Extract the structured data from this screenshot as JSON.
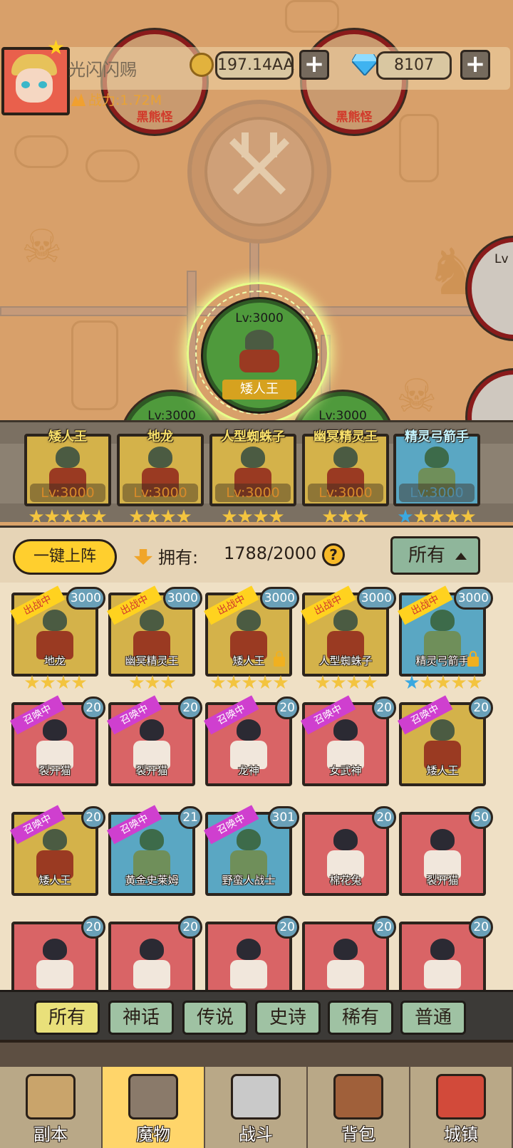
{
  "player": {
    "name": "光闪闪赐",
    "power_label": "战力:1.72M",
    "gold": "197.14AA",
    "gems": "8107"
  },
  "map": {
    "nodes": [
      {
        "label": "黑熊怪"
      },
      {
        "label": "黑熊怪"
      }
    ],
    "hero_node": {
      "level": "Lv:3000",
      "name": "矮人王"
    },
    "side_level": "Lv",
    "partial_levels": [
      "Lv:3000",
      "Lv:3000"
    ]
  },
  "lineup": [
    {
      "name": "矮人王",
      "level": "Lv:3000",
      "stars": 5,
      "blue_stars": 0,
      "color": "gold"
    },
    {
      "name": "地龙",
      "level": "Lv:3000",
      "stars": 4,
      "blue_stars": 0,
      "color": "gold"
    },
    {
      "name": "人型蜘蛛子",
      "level": "Lv:3000",
      "stars": 4,
      "blue_stars": 0,
      "color": "gold"
    },
    {
      "name": "幽冥精灵王",
      "level": "Lv:3000",
      "stars": 3,
      "blue_stars": 0,
      "color": "gold"
    },
    {
      "name": "精灵弓箭手",
      "level": "Lv:3000",
      "stars": 5,
      "blue_stars": 1,
      "color": "blue"
    }
  ],
  "toolbar": {
    "one_key_label": "一键上阵",
    "own_label": "拥有:",
    "own_count": "1788/2000",
    "help_symbol": "?",
    "filter_label": "所有"
  },
  "tags": {
    "battle": "出战中",
    "summon": "召唤中"
  },
  "monsters": [
    {
      "name": "地龙",
      "count": "3000",
      "tag": "battle",
      "color": "gold",
      "stars": 4,
      "blue_stars": 0,
      "locked": false
    },
    {
      "name": "幽冥精灵王",
      "count": "3000",
      "tag": "battle",
      "color": "gold",
      "stars": 3,
      "blue_stars": 0,
      "locked": false
    },
    {
      "name": "矮人王",
      "count": "3000",
      "tag": "battle",
      "color": "gold",
      "stars": 5,
      "blue_stars": 0,
      "locked": true
    },
    {
      "name": "人型蜘蛛子",
      "count": "3000",
      "tag": "battle",
      "color": "gold",
      "stars": 4,
      "blue_stars": 0,
      "locked": false
    },
    {
      "name": "精灵弓箭手",
      "count": "3000",
      "tag": "battle",
      "color": "blue",
      "stars": 5,
      "blue_stars": 1,
      "locked": true
    },
    {
      "name": "裂开猫",
      "count": "20",
      "tag": "summon",
      "color": "red",
      "stars": 0,
      "blue_stars": 0,
      "locked": false
    },
    {
      "name": "裂开猫",
      "count": "20",
      "tag": "summon",
      "color": "red",
      "stars": 0,
      "blue_stars": 0,
      "locked": false
    },
    {
      "name": "龙神",
      "count": "20",
      "tag": "summon",
      "color": "red",
      "stars": 0,
      "blue_stars": 0,
      "locked": false
    },
    {
      "name": "女武神",
      "count": "20",
      "tag": "summon",
      "color": "red",
      "stars": 0,
      "blue_stars": 0,
      "locked": false
    },
    {
      "name": "矮人王",
      "count": "20",
      "tag": "summon",
      "color": "gold",
      "stars": 0,
      "blue_stars": 0,
      "locked": false
    },
    {
      "name": "矮人王",
      "count": "20",
      "tag": "summon",
      "color": "gold",
      "stars": 0,
      "blue_stars": 0,
      "locked": false
    },
    {
      "name": "黄金史莱姆",
      "count": "21",
      "tag": "summon",
      "color": "blue",
      "stars": 0,
      "blue_stars": 0,
      "locked": false
    },
    {
      "name": "野蛮人战士",
      "count": "301",
      "tag": "summon",
      "color": "blue",
      "stars": 0,
      "blue_stars": 0,
      "locked": false
    },
    {
      "name": "棉花兔",
      "count": "20",
      "tag": "",
      "color": "red",
      "stars": 0,
      "blue_stars": 0,
      "locked": false
    },
    {
      "name": "裂开猫",
      "count": "50",
      "tag": "",
      "color": "red",
      "stars": 0,
      "blue_stars": 0,
      "locked": false
    },
    {
      "name": "",
      "count": "20",
      "tag": "",
      "color": "red",
      "stars": 0,
      "blue_stars": 0,
      "locked": false
    },
    {
      "name": "",
      "count": "20",
      "tag": "",
      "color": "red",
      "stars": 0,
      "blue_stars": 0,
      "locked": false
    },
    {
      "name": "",
      "count": "20",
      "tag": "",
      "color": "red",
      "stars": 0,
      "blue_stars": 0,
      "locked": false
    },
    {
      "name": "",
      "count": "20",
      "tag": "",
      "color": "red",
      "stars": 0,
      "blue_stars": 0,
      "locked": false
    },
    {
      "name": "",
      "count": "20",
      "tag": "",
      "color": "red",
      "stars": 0,
      "blue_stars": 0,
      "locked": false
    }
  ],
  "rarity_tabs": [
    "所有",
    "神话",
    "传说",
    "史诗",
    "稀有",
    "普通"
  ],
  "rarity_active": 0,
  "nav": [
    {
      "label": "副本",
      "icon": "map-scroll-icon"
    },
    {
      "label": "魔物",
      "icon": "monster-helmet-icon"
    },
    {
      "label": "战斗",
      "icon": "crossed-swords-icon"
    },
    {
      "label": "背包",
      "icon": "backpack-icon"
    },
    {
      "label": "城镇",
      "icon": "town-shop-icon"
    }
  ],
  "nav_active": 1,
  "colors": {
    "gold_frame": "#d4b24a",
    "blue_frame": "#5aa7c3",
    "red_frame": "#d96466",
    "accent_yellow": "#ffcf2e",
    "summon_tag": "#cf3fcf",
    "battle_tag": "#ffd21f"
  }
}
